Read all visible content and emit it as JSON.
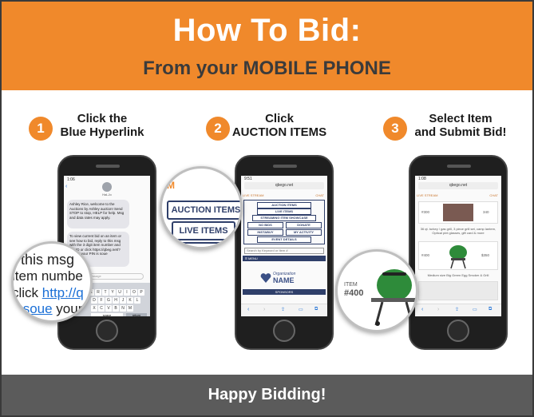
{
  "header": {
    "title": "How To Bid:",
    "subtitle": "From your MOBILE PHONE"
  },
  "steps": [
    {
      "number": "1",
      "label_line1": "Click the",
      "label_line2": "Blue Hyperlink",
      "phone": {
        "time": "1:06",
        "contact": "Hal-Jo",
        "message1": "Ashley Rice, welcome to the Auctions by Ashley auction! Send STOP to stop, HELP for help. Msg and data rates may apply.",
        "message2": "To view current bid on an item or see how to bid, reply to this msg with the 3 digit item number and SEND or click https://qbeg.net/?i=soue your PIN is soue",
        "input_placeholder": "Text Message",
        "space_key": "space",
        "return_key": "return"
      },
      "magnifier": {
        "line1": "o this msg",
        "line2": "item numbe",
        "line3_prefix": "click ",
        "line3_link": "http://q",
        "line4_link": "i=soue",
        "line4_suffix": " your"
      }
    },
    {
      "number": "2",
      "label_line1": "Click",
      "label_line2": "AUCTION ITEMS",
      "phone": {
        "time": "9:51",
        "url": "qbego.net",
        "live_stream": "LIVE STREAM",
        "chat": "CHAT",
        "menu_items": [
          "AUCTION ITEMS",
          "LIVE ITEMS",
          "STREAMING ITEM SHOWCASE",
          "NO BIDS",
          "DONATE",
          "INSTABUY",
          "MY ACTIVITY",
          "EVENT DETAILS"
        ],
        "search_placeholder": "Search by Keyword or Item #",
        "menu_label": "MENU",
        "org_line1": "Organization",
        "org_line2": "NAME",
        "sponsors": "SPONSORS"
      },
      "magnifier": {
        "fragment": "M",
        "item1": "AUCTION ITEMS",
        "item2": "LIVE ITEMS",
        "item3": "IG ITEM"
      }
    },
    {
      "number": "3",
      "label_line1": "Select Item",
      "label_line2": "and Submit Bid!",
      "phone": {
        "time": "1:08",
        "url": "qbego.net",
        "live_stream": "LIVE STREAM",
        "chat": "CHAT",
        "item_top": "#300",
        "item_top_right": "340",
        "caption1": "36 qt. turkey / gas grill, 3 piece grill set, camp lantern, Optical pint glasses, gift card & more",
        "item_left": "#400",
        "item_right": "$350",
        "caption2": "Medium size Big Green Egg Smoker & Grill"
      },
      "magnifier": {
        "item_label": "ITEM",
        "item_number": "#400"
      }
    }
  ],
  "footer": {
    "text": "Happy Bidding!"
  },
  "colors": {
    "accent": "#f0892b",
    "footer": "#5b5b5b",
    "navy": "#2f3f6a",
    "link": "#1a6fd6"
  }
}
